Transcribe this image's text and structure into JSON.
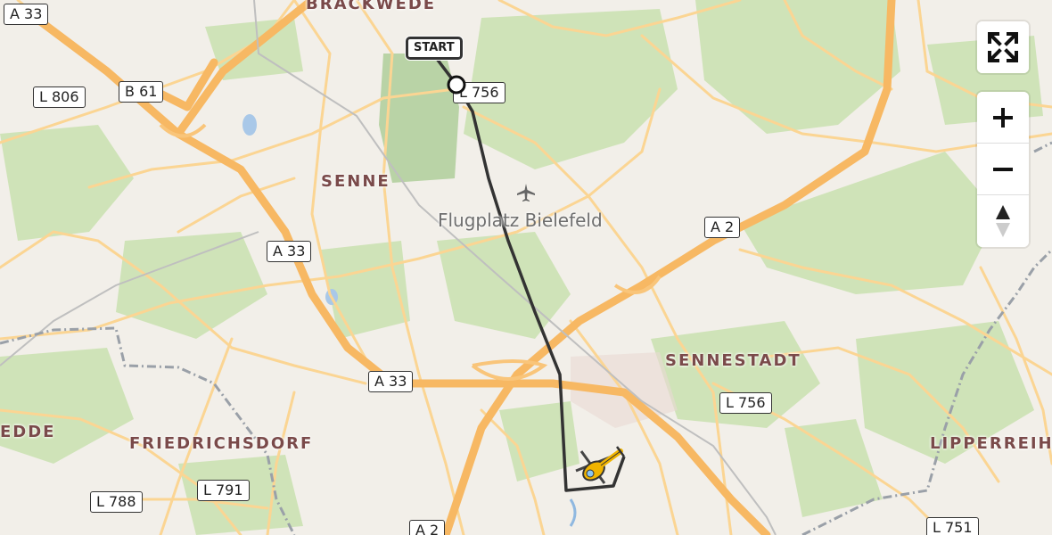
{
  "map": {
    "places": {
      "brackwede": "BRACKWEDE",
      "senne": "SENNE",
      "sennestadt": "SENNESTADT",
      "friedrichsdorf": "FRIEDRICHSDORF",
      "edde": "EDDE",
      "lipperreihe": "LIPPERREIHE"
    },
    "poi": {
      "airfield": "Flugplatz Bielefeld",
      "airfield_icon": "airplane-icon"
    },
    "shields": {
      "a33_top": "A 33",
      "l806": "L 806",
      "b61": "B 61",
      "l756_top": "L 756",
      "a33_mid": "A 33",
      "a2_right": "A 2",
      "a33_low": "A 33",
      "l756_right": "L 756",
      "l788": "L 788",
      "l791": "L 791",
      "a2_bottom": "A 2",
      "l751": "L 751"
    },
    "route": {
      "start_label": "START",
      "start_icon": "start-marker-icon",
      "end_icon": "helicopter-icon",
      "color": "#333333"
    },
    "colors": {
      "background": "#f2efe9",
      "motorway": "#f7b863",
      "road": "#fbd593",
      "forest": "#cfe3b8",
      "border": "#9aa0a8"
    }
  },
  "controls": {
    "fullscreen_icon": "fullscreen-icon",
    "zoom_in_icon": "zoom-in-icon",
    "zoom_out_icon": "zoom-out-icon",
    "compass_icon": "compass-icon"
  }
}
